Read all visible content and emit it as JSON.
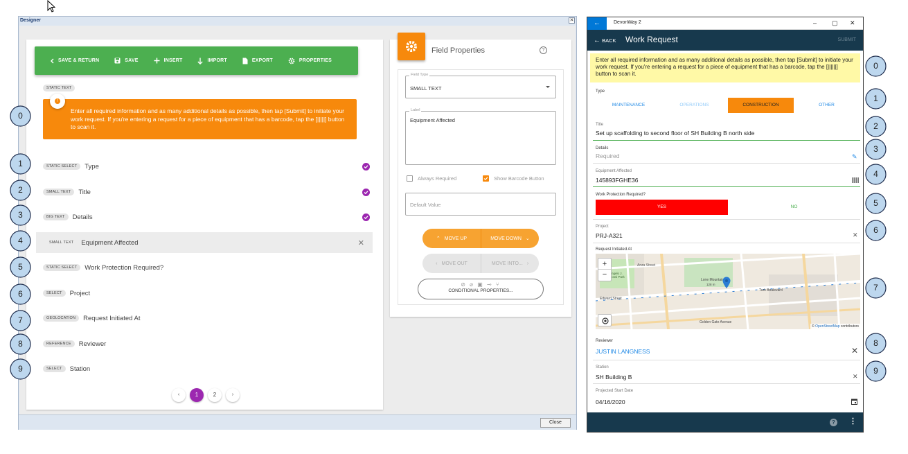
{
  "designer": {
    "window_title": "Designer",
    "toolbar": {
      "save_return": "SAVE & RETURN",
      "save": "SAVE",
      "insert": "INSERT",
      "import": "IMPORT",
      "export": "EXPORT",
      "properties": "PROPERTIES"
    },
    "static_chip": "STATIC TEXT",
    "static_text": "Enter all required information and as many additional details as possible, then tap [Submit] to initiate your work request. If you're entering a request for a piece of equipment that has a barcode, tap the [|||||] button to scan it.",
    "fields": [
      {
        "chip": "STATIC SELECT",
        "name": "Type",
        "checked": true
      },
      {
        "chip": "SMALL TEXT",
        "name": "Title",
        "checked": true
      },
      {
        "chip": "BIG TEXT",
        "name": "Details",
        "checked": true
      },
      {
        "chip": "SMALL TEXT",
        "name": "Equipment Affected",
        "selected": true
      },
      {
        "chip": "STATIC SELECT",
        "name": "Work Protection Required?"
      },
      {
        "chip": "SELECT",
        "name": "Project"
      },
      {
        "chip": "GEOLOCATION",
        "name": "Request Initiated At"
      },
      {
        "chip": "REFERENCE",
        "name": "Reviewer"
      },
      {
        "chip": "SELECT",
        "name": "Station"
      }
    ],
    "pager": {
      "prev": "‹",
      "pages": [
        "1",
        "2"
      ],
      "next": "›",
      "active": "1"
    },
    "close_label": "Close",
    "field_properties": {
      "title": "Field Properties",
      "field_type_label": "Field Type",
      "field_type_value": "SMALL TEXT",
      "label_label": "Label",
      "label_value": "Equipment Affected",
      "always_required": "Always Required",
      "always_required_checked": false,
      "show_barcode": "Show Barcode Button",
      "show_barcode_checked": true,
      "default_value_placeholder": "Default Value",
      "move_up": "MOVE UP",
      "move_down": "MOVE DOWN",
      "move_out": "MOVE OUT",
      "move_into": "MOVE INTO...",
      "conditional": "CONDITIONAL PROPERTIES..."
    },
    "accent_orange": "#f7890c",
    "accent_green": "#4caf50",
    "accent_purple": "#9c27b0"
  },
  "callouts_left": [
    "0",
    "1",
    "2",
    "3",
    "4",
    "5",
    "6",
    "7",
    "8",
    "9"
  ],
  "callouts_right": [
    "0",
    "1",
    "2",
    "3",
    "4",
    "5",
    "6",
    "7",
    "8",
    "9"
  ],
  "mobile": {
    "app_title": "DevonWay 2",
    "back_label": "BACK",
    "page_title": "Work Request",
    "submit_label": "SUBMIT",
    "instructions": "Enter all required information and as many additional details as possible, then tap [Submit] to initiate your work request. If you're entering a request for a piece of equipment that has a barcode, tap the [||||||] button to scan it.",
    "type_label": "Type",
    "type_options": [
      "MAINTENANCE",
      "OPERATIONS",
      "CONSTRUCTION",
      "OTHER"
    ],
    "type_selected": "CONSTRUCTION",
    "title_label": "Title",
    "title_value": "Set up scaffolding to second floor of SH Building B north side",
    "details_label": "Details",
    "details_placeholder": "Required",
    "equipment_label": "Equipment Affected",
    "equipment_value": "145893FGHE36",
    "protection_label": "Work Protection Required?",
    "protection_yes": "YES",
    "protection_no": "NO",
    "project_label": "Project",
    "project_value": "PRJ-A321",
    "location_label": "Request Initiated At",
    "map_labels": {
      "anza": "Anza Street",
      "turk": "Turk Boulevard",
      "edward": "Edward Street",
      "golden_gate": "Golden Gate Avenue",
      "lone_mountain": "Lone Mountain",
      "lone_mountain_elev": "128 m",
      "rossi": "Angelo J. Rossi Park",
      "attribution_prefix": "© ",
      "attribution_link": "OpenStreetMap",
      "attribution_suffix": " contributors",
      "zoom_in": "+",
      "zoom_out": "−"
    },
    "reviewer_label": "Reviewer",
    "reviewer_value": "JUSTIN LANGNESS",
    "station_label": "Station",
    "station_value": "SH Building B",
    "start_date_label": "Projected Start Date",
    "start_date_value": "04/16/2020",
    "yes_color": "#ff0000",
    "appbar_color": "#17394d"
  }
}
